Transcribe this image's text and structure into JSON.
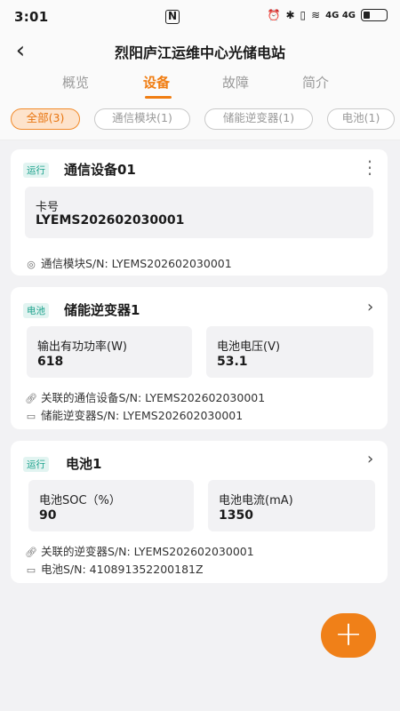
{
  "status_bar": {
    "time": "3:01",
    "nfc": "N",
    "network": "4G 4G",
    "battery_level": 0.3
  },
  "header": {
    "title": "烈阳庐江运维中心光储电站"
  },
  "tabs": [
    {
      "label": "概览"
    },
    {
      "label": "设备"
    },
    {
      "label": "故障"
    },
    {
      "label": "简介"
    }
  ],
  "filters": [
    {
      "label": "全部(3)"
    },
    {
      "label": "通信模块(1)"
    },
    {
      "label": "储能逆变器(1)"
    },
    {
      "label": "电池(1)"
    }
  ],
  "cards": [
    {
      "tag": "运行",
      "title": "通信设备01",
      "box": {
        "label": "卡号",
        "value": "LYEMS202602030001"
      },
      "info": [
        "通信模块S/N: LYEMS202602030001"
      ]
    },
    {
      "tag": "电池",
      "title": "储能逆变器1",
      "boxes": [
        {
          "label": "输出有功功率(W)",
          "value": "618"
        },
        {
          "label": "电池电压(V)",
          "value": "53.1"
        }
      ],
      "info": [
        "关联的通信设备S/N: LYEMS202602030001",
        "储能逆变器S/N: LYEMS202602030001"
      ]
    },
    {
      "tag": "运行",
      "title": "电池1",
      "boxes": [
        {
          "label": "电池SOC（%）",
          "value": "90"
        },
        {
          "label": "电池电流(mA)",
          "value": "1350"
        }
      ],
      "info": [
        "关联的逆变器S/N: LYEMS202602030001",
        "电池S/N: 410891352200181Z"
      ]
    }
  ],
  "fab": {
    "label": "+"
  },
  "colors": {
    "accent": "#f07d12",
    "tag_bg": "#e2f4f1",
    "tag_text": "#18a08a"
  }
}
